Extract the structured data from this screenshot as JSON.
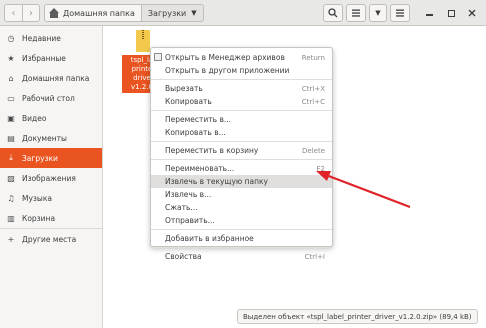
{
  "header": {
    "nav_back": "‹",
    "nav_forward": "›",
    "breadcrumbs": [
      "Домашняя папка",
      "Загрузки"
    ],
    "buttons": [
      "search-icon",
      "view-list-icon",
      "view-options-icon",
      "menu-icon"
    ]
  },
  "window_controls": [
    "minimize-icon",
    "maximize-icon",
    "close-icon"
  ],
  "sidebar": {
    "items": [
      {
        "label": "Недавние",
        "icon": "clock-icon"
      },
      {
        "label": "Избранные",
        "icon": "star-icon"
      },
      {
        "label": "Домашняя папка",
        "icon": "home-icon"
      },
      {
        "label": "Рабочий стол",
        "icon": "desktop-icon"
      },
      {
        "label": "Видео",
        "icon": "video-icon"
      },
      {
        "label": "Документы",
        "icon": "document-icon"
      },
      {
        "label": "Загрузки",
        "icon": "download-icon",
        "active": true
      },
      {
        "label": "Изображения",
        "icon": "image-icon"
      },
      {
        "label": "Музыка",
        "icon": "music-icon"
      },
      {
        "label": "Корзина",
        "icon": "trash-icon"
      },
      {
        "label": "Другие места",
        "icon": "plus-icon"
      }
    ]
  },
  "file": {
    "label_lines": [
      "tspl_la",
      "printe",
      "drive",
      "v1.2.0"
    ],
    "icon": "zip-archive-icon"
  },
  "context_menu": {
    "items": [
      {
        "label": "Открыть в Менеджер архивов",
        "accel": "Return",
        "has_icon": true
      },
      {
        "label": "Открыть в другом приложении",
        "accel": ""
      },
      {
        "sep": true
      },
      {
        "label": "Вырезать",
        "accel": "Ctrl+X"
      },
      {
        "label": "Копировать",
        "accel": "Ctrl+C"
      },
      {
        "sep": true
      },
      {
        "label": "Переместить в...",
        "accel": ""
      },
      {
        "label": "Копировать в...",
        "accel": ""
      },
      {
        "sep": true
      },
      {
        "label": "Переместить в корзину",
        "accel": "Delete"
      },
      {
        "sep": true
      },
      {
        "label": "Переименовать...",
        "accel": "F2"
      },
      {
        "label": "Извлечь в текущую папку",
        "accel": "",
        "highlight": true
      },
      {
        "label": "Извлечь в...",
        "accel": ""
      },
      {
        "label": "Сжать...",
        "accel": ""
      },
      {
        "label": "Отправить...",
        "accel": ""
      },
      {
        "sep": true
      },
      {
        "label": "Добавить в избранное",
        "accel": ""
      },
      {
        "sep": true
      },
      {
        "label": "Свойства",
        "accel": "Ctrl+I"
      }
    ]
  },
  "status": {
    "text": "Выделен объект «tspl_label_printer_driver_v1.2.0.zip» (89,4 kB)"
  },
  "colors": {
    "accent": "#e95420",
    "annotation_arrow": "#e0242a"
  }
}
